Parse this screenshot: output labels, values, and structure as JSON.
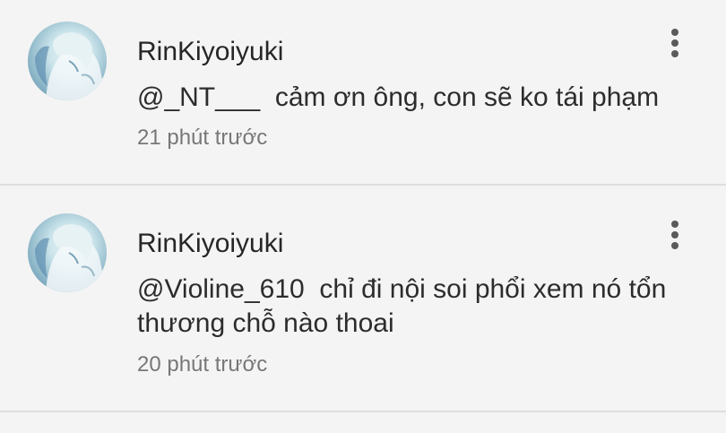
{
  "comments": [
    {
      "username": "RinKiyoiyuki",
      "mention": "@_NT___",
      "text": "cảm ơn ông, con sẽ ko tái phạm",
      "time": "21 phút trước",
      "avatar_icon": "anime-avatar-icon",
      "more_icon": "vertical-ellipsis-icon"
    },
    {
      "username": "RinKiyoiyuki",
      "mention": "@Violine_610",
      "text": "chỉ đi nội soi phổi xem nó tổn thương chỗ nào thoai",
      "time": "20 phút trước",
      "avatar_icon": "anime-avatar-icon",
      "more_icon": "vertical-ellipsis-icon"
    }
  ],
  "colors": {
    "background": "#f4f4f4",
    "divider": "#dedede",
    "text_primary": "#262626",
    "text_secondary": "#777777",
    "avatar_accent": "#8fb8c9"
  }
}
